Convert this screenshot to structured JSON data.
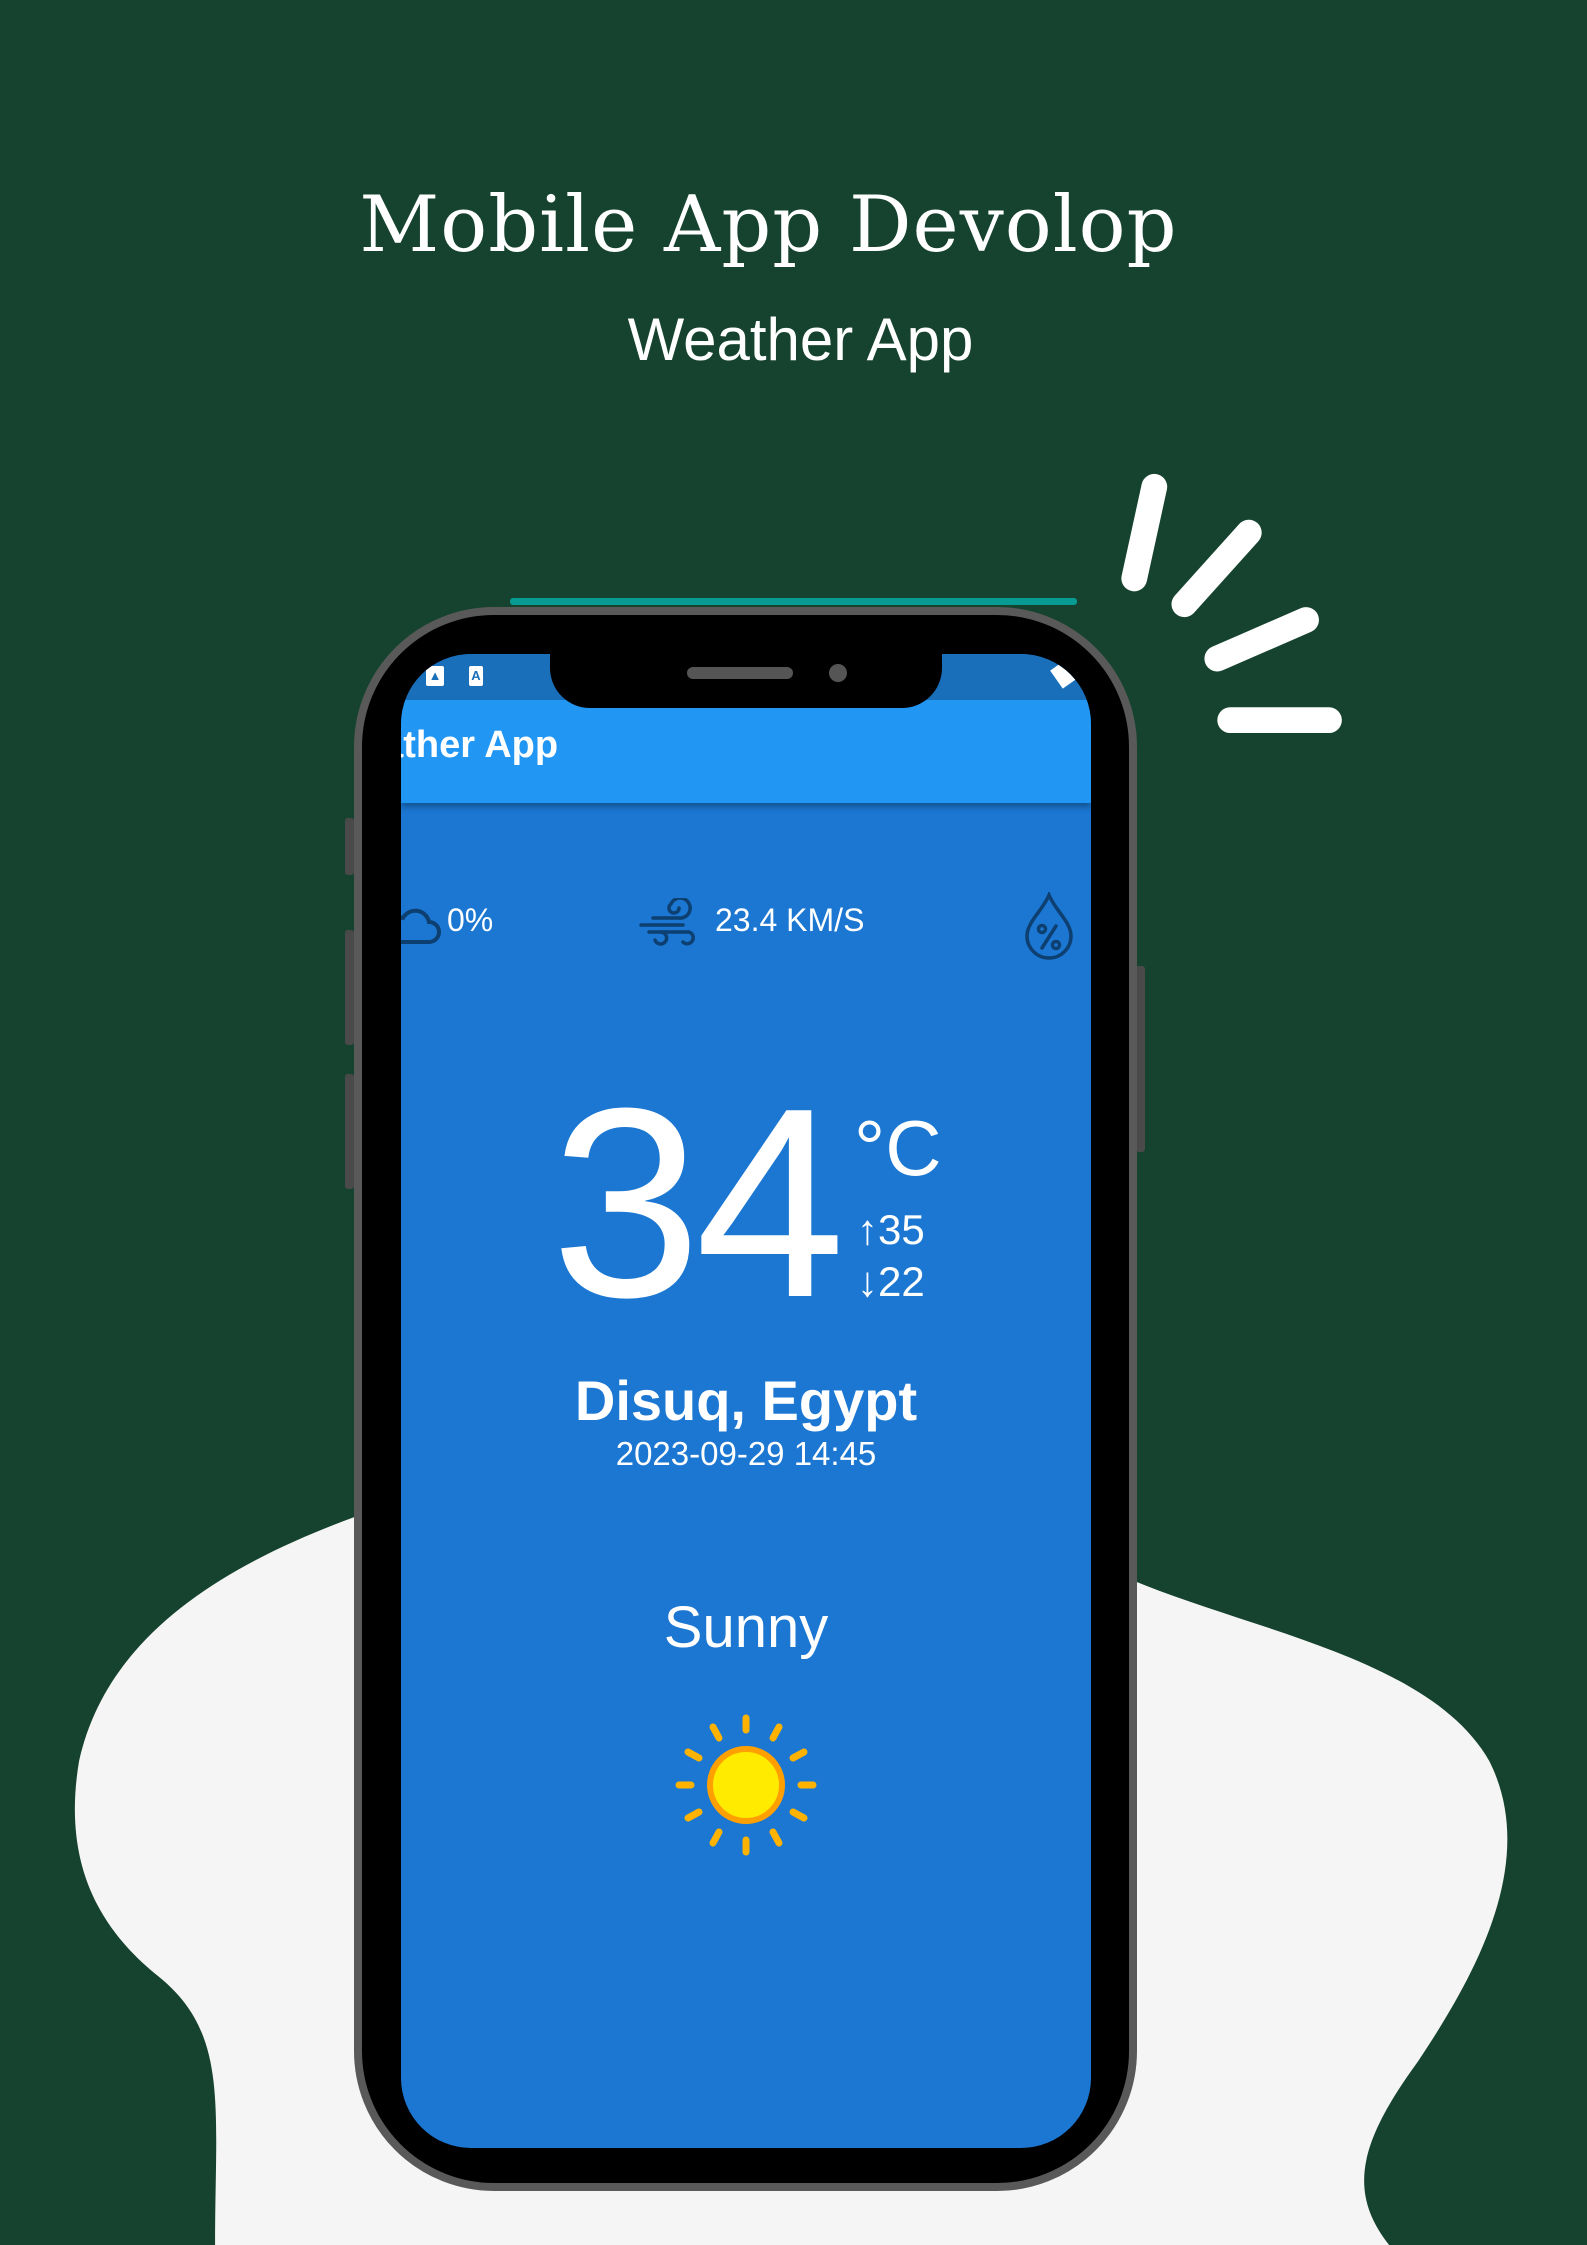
{
  "poster": {
    "title": "Mobile App Devolop",
    "subtitle": "Weather App",
    "colors": {
      "background": "#16432f",
      "blob": "#f5f5f5",
      "accent": "#089b94"
    }
  },
  "app": {
    "appbar_title": "eather App",
    "stats": {
      "cloud": "0%",
      "wind": "23.4 KM/S"
    },
    "temperature": "34",
    "unit": "°C",
    "high": "35",
    "low": "22",
    "location": "Disuq, Egypt",
    "datetime": "2023-09-29 14:45",
    "condition": "Sunny",
    "colors": {
      "primary": "#2196f3",
      "background": "#1b77d2"
    }
  }
}
